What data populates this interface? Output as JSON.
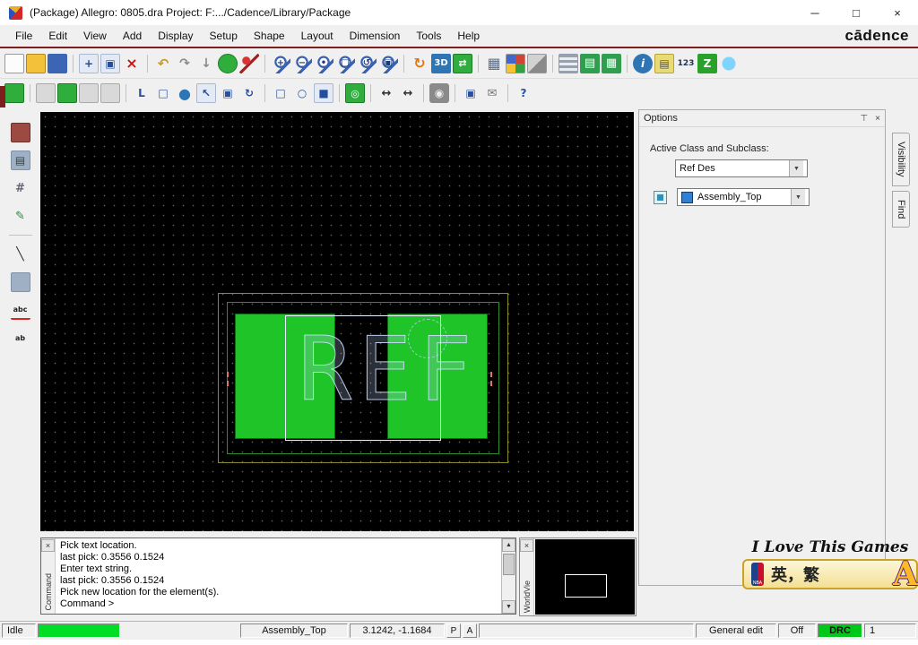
{
  "ui": {
    "up": "▲",
    "down": "▼",
    "dropdown": "▼",
    "pin": "⊤",
    "close": "×"
  },
  "window": {
    "title": "(Package) Allegro: 0805.dra  Project: F:.../Cadence/Library/Package",
    "minimize": "─",
    "maximize": "□",
    "close": "×"
  },
  "menu": {
    "items": [
      "File",
      "Edit",
      "View",
      "Add",
      "Display",
      "Setup",
      "Shape",
      "Layout",
      "Dimension",
      "Tools",
      "Help"
    ],
    "brand": "cādence"
  },
  "toolbar_row1": [
    {
      "name": "new-file",
      "glyph": ""
    },
    {
      "name": "open-file",
      "glyph": ""
    },
    {
      "name": "save",
      "glyph": ""
    },
    {
      "name": "move",
      "glyph": "+"
    },
    {
      "name": "copy",
      "glyph": "▣"
    },
    {
      "name": "delete",
      "glyph": "×"
    },
    {
      "name": "undo",
      "glyph": "↶"
    },
    {
      "name": "redo",
      "glyph": "↷"
    },
    {
      "name": "paste-down",
      "glyph": "↓"
    },
    {
      "name": "fix",
      "glyph": ""
    },
    {
      "name": "pushpin",
      "glyph": ""
    },
    {
      "name": "zoom-in",
      "glyph": "+"
    },
    {
      "name": "zoom-out",
      "glyph": "−"
    },
    {
      "name": "zoom-points",
      "glyph": "•"
    },
    {
      "name": "zoom-fit",
      "glyph": "□"
    },
    {
      "name": "zoom-previous",
      "glyph": "↺"
    },
    {
      "name": "zoom-world",
      "glyph": "▣"
    },
    {
      "name": "redraw",
      "glyph": "↻"
    },
    {
      "name": "view-3d",
      "glyph": "3D"
    },
    {
      "name": "flip-design",
      "glyph": "⇄"
    },
    {
      "name": "grid-toggle",
      "glyph": "▦"
    },
    {
      "name": "color-dialog",
      "glyph": ""
    },
    {
      "name": "shadow-mode",
      "glyph": ""
    },
    {
      "name": "cross-section",
      "glyph": ""
    },
    {
      "name": "property-edit",
      "glyph": "▤"
    },
    {
      "name": "spreadsheet",
      "glyph": "▦"
    },
    {
      "name": "info",
      "glyph": "i"
    },
    {
      "name": "reports",
      "glyph": "▤"
    },
    {
      "name": "auto-number",
      "glyph": "123"
    },
    {
      "name": "waive-drc",
      "glyph": "Z"
    },
    {
      "name": "world-globe",
      "glyph": ""
    }
  ],
  "toolbar_row2": [
    {
      "name": "shape-add",
      "glyph": ""
    },
    {
      "name": "shape-select",
      "glyph": ""
    },
    {
      "name": "shape-edit",
      "glyph": ""
    },
    {
      "name": "shape-merge",
      "glyph": ""
    },
    {
      "name": "shape-delete",
      "glyph": ""
    },
    {
      "name": "add-line",
      "glyph": "L"
    },
    {
      "name": "add-rectangle",
      "glyph": "□"
    },
    {
      "name": "add-circle",
      "glyph": "●"
    },
    {
      "name": "select-cursor",
      "glyph": "↖"
    },
    {
      "name": "text-frame",
      "glyph": "▣"
    },
    {
      "name": "rotate",
      "glyph": "↻"
    },
    {
      "name": "rect-outline",
      "glyph": "□"
    },
    {
      "name": "circle-outline",
      "glyph": "○"
    },
    {
      "name": "region-select",
      "glyph": "■"
    },
    {
      "name": "padstack-place",
      "glyph": "◎"
    },
    {
      "name": "dimension-linear",
      "glyph": "↔"
    },
    {
      "name": "dimension-measure",
      "glyph": "↔"
    },
    {
      "name": "snapshot-camera",
      "glyph": "◉"
    },
    {
      "name": "copy-objects",
      "glyph": "▣"
    },
    {
      "name": "export-mail",
      "glyph": "✉"
    },
    {
      "name": "help",
      "glyph": "?"
    }
  ],
  "left_toolbar": [
    {
      "name": "etch-tool",
      "glyph": ""
    },
    {
      "name": "layer-tool",
      "glyph": "▤"
    },
    {
      "name": "grid-points",
      "glyph": "#"
    },
    {
      "name": "sketch-pencil",
      "glyph": "✎"
    },
    {
      "name": "line-tool",
      "glyph": "╲"
    },
    {
      "name": "shape-tool",
      "glyph": ""
    },
    {
      "name": "add-text",
      "glyph": "abc"
    },
    {
      "name": "text-style",
      "glyph": "ab"
    }
  ],
  "canvas": {
    "ref_text": "REF"
  },
  "options_panel": {
    "title": "Options",
    "active_class_label": "Active Class and Subclass:",
    "class_value": "Ref Des",
    "subclass_value": "Assembly_Top",
    "tabs": [
      "Visibility",
      "Find"
    ]
  },
  "console": {
    "label": "Command",
    "lines": [
      "Pick text location.",
      "last pick: 0.3556  0.1524",
      "Enter text string.",
      "last pick: 0.3556  0.1524",
      "Pick new location for the element(s).",
      "Command >"
    ]
  },
  "world_view": {
    "label": "WorldVie"
  },
  "overlay": {
    "script_text": "I Love This Games",
    "ime_text": "英，繁",
    "nba_label": "NBA",
    "logo_letter": "A"
  },
  "status_bar": {
    "state": "Idle",
    "layer": "Assembly_Top",
    "coords": "3.1242, -1.1684",
    "pick": "P",
    "angle": "A",
    "mode": "General edit",
    "power": "Off",
    "drc": "DRC",
    "count": "1"
  }
}
